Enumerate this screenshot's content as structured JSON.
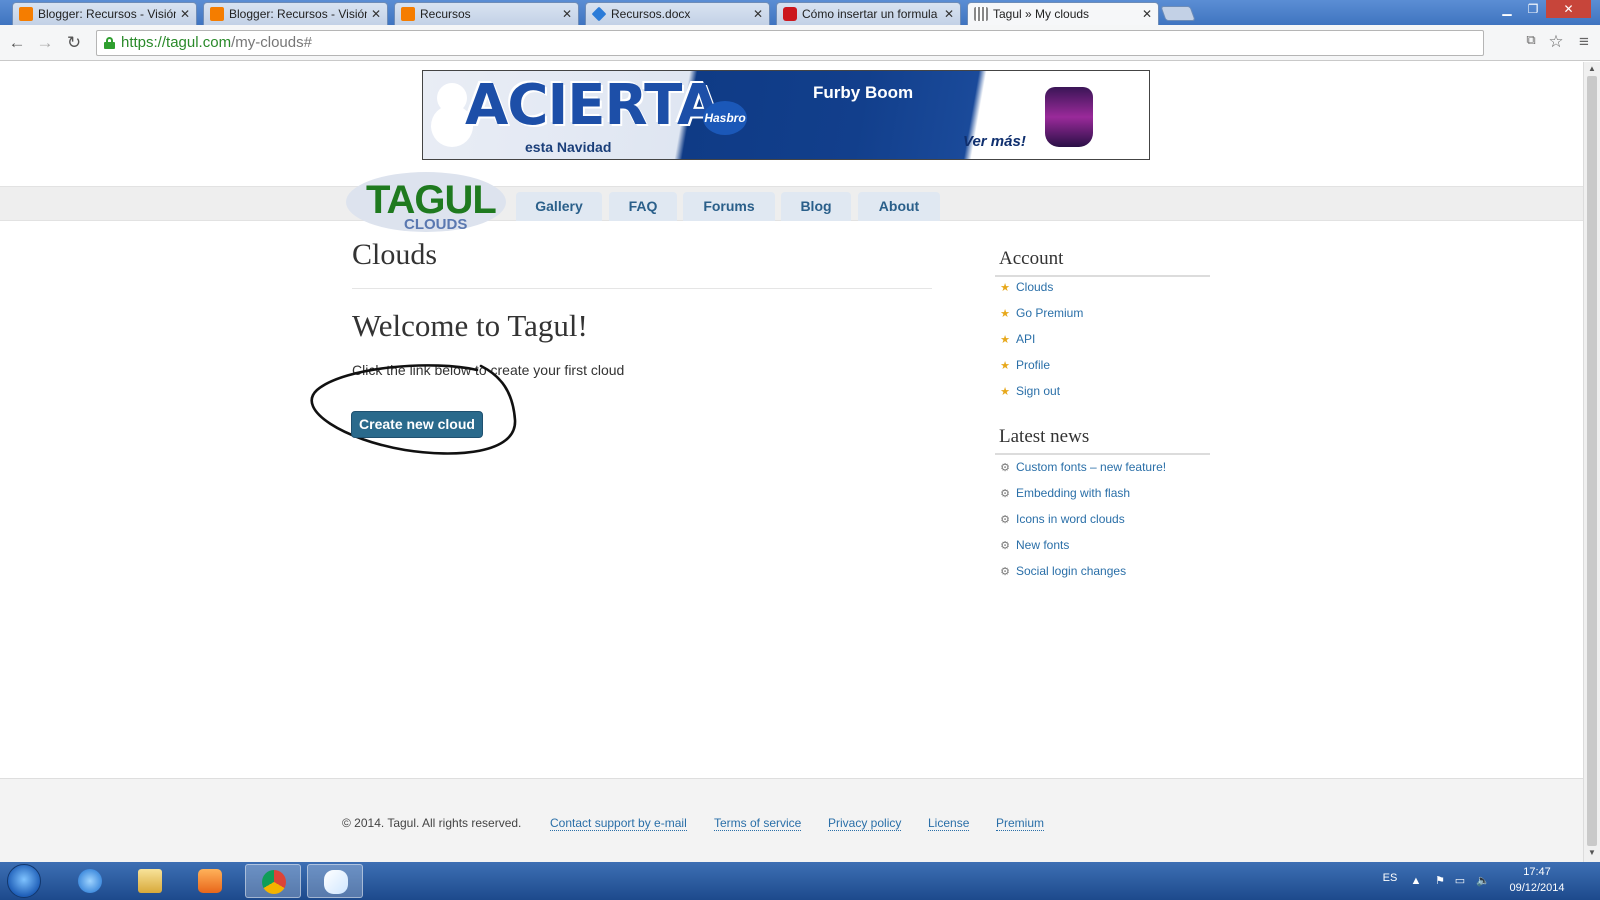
{
  "browser": {
    "tabs": [
      {
        "title": "Blogger: Recursos - Visión",
        "favicon": "blogger-icon",
        "active": false
      },
      {
        "title": "Blogger: Recursos - Visión",
        "favicon": "blogger-icon",
        "active": false
      },
      {
        "title": "Recursos",
        "favicon": "blogger-icon",
        "active": false
      },
      {
        "title": "Recursos.docx",
        "favicon": "dropbox-icon",
        "active": false
      },
      {
        "title": "Cómo insertar un formula",
        "favicon": "youtube-icon",
        "active": false
      },
      {
        "title": "Tagul » My clouds",
        "favicon": "tagul-icon",
        "active": true
      }
    ],
    "url": {
      "scheme": "https://",
      "host": "tagul.com",
      "path": "/my-clouds#"
    }
  },
  "ad": {
    "headline": "ACIERTA",
    "subtitle": "esta Navidad",
    "brand": "Hasbro",
    "product": "Furby Boom",
    "cta": "Ver más!"
  },
  "logo": {
    "word": "TAGUL",
    "subword": "CLOUDS"
  },
  "nav": {
    "tabs": [
      "Gallery",
      "FAQ",
      "Forums",
      "Blog",
      "About"
    ]
  },
  "main": {
    "title": "Clouds",
    "welcome": "Welcome to Tagul!",
    "hint": "Click the link below to create your first cloud",
    "create_button": "Create new cloud"
  },
  "sidebar": {
    "account_title": "Account",
    "account_links": [
      "Clouds",
      "Go Premium",
      "API",
      "Profile",
      "Sign out"
    ],
    "news_title": "Latest news",
    "news_links": [
      "Custom fonts – new feature!",
      "Embedding with flash",
      "Icons in word clouds",
      "New fonts",
      "Social login changes"
    ]
  },
  "footer": {
    "copyright": "© 2014. Tagul. All rights reserved.",
    "links": [
      "Contact support by e-mail",
      "Terms of service",
      "Privacy policy",
      "License",
      "Premium"
    ]
  },
  "taskbar": {
    "language": "ES",
    "time": "17:47",
    "date": "09/12/2014"
  },
  "colors": {
    "link": "#2a6fa8",
    "button": "#2a6a8c",
    "logo_green": "#1f7a1f"
  }
}
